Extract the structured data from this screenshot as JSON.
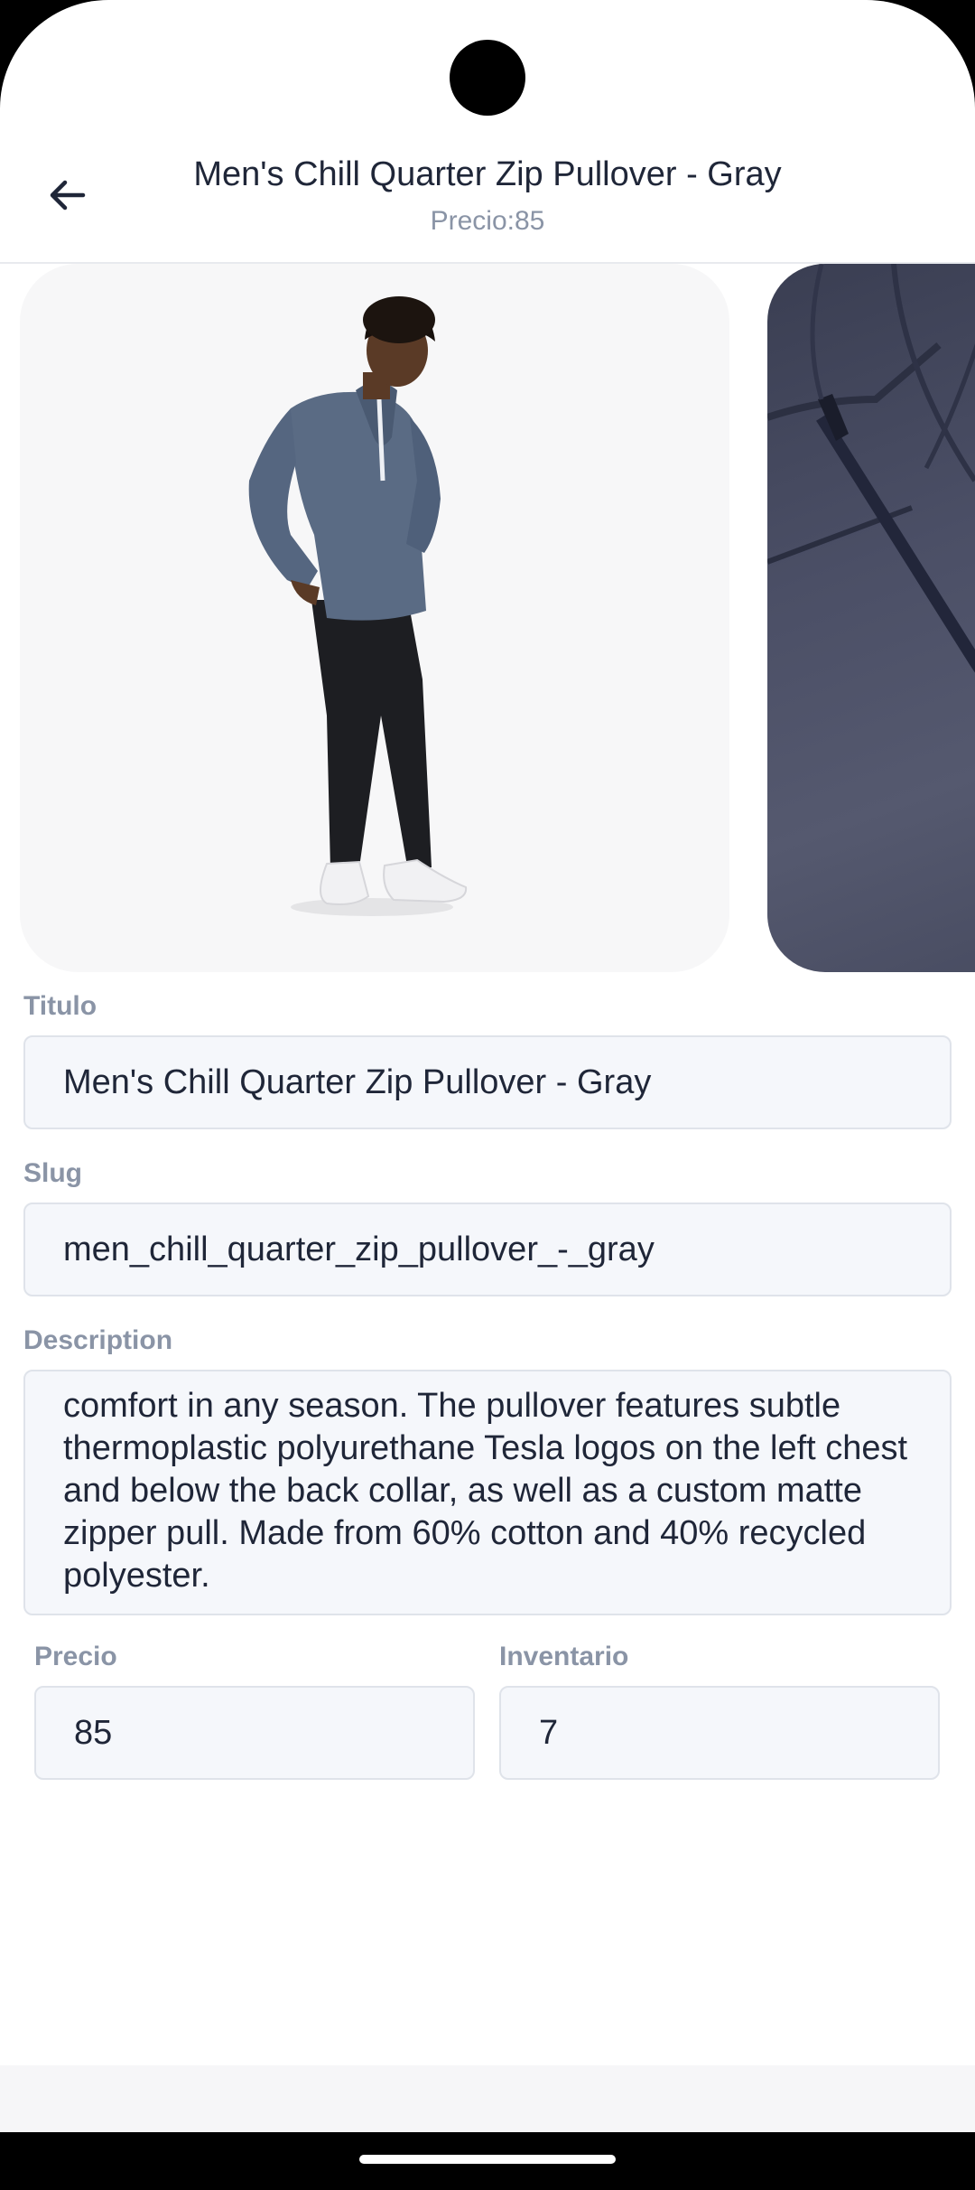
{
  "header": {
    "title": "Men's Chill Quarter Zip Pullover - Gray",
    "subtitle": "Precio:85"
  },
  "icons": {
    "back": "arrow-left-icon"
  },
  "gallery": {
    "images": [
      "product-model-image",
      "product-detail-zipper-image"
    ]
  },
  "form": {
    "title_label": "Titulo",
    "title_value": "Men's Chill Quarter Zip Pullover - Gray",
    "slug_label": "Slug",
    "slug_value": "men_chill_quarter_zip_pullover_-_gray",
    "description_label": "Description",
    "description_value": "comfort in any season. The pullover features subtle thermoplastic polyurethane Tesla logos on the left chest and below the back collar, as well as a custom matte zipper pull. Made from 60% cotton and 40% recycled polyester.",
    "price_label": "Precio",
    "price_value": "85",
    "inventory_label": "Inventario",
    "inventory_value": "7"
  },
  "colors": {
    "text": "#1f2638",
    "label": "#8a94a6",
    "field_bg": "#f5f7fb",
    "field_border": "#dfe3ea"
  }
}
